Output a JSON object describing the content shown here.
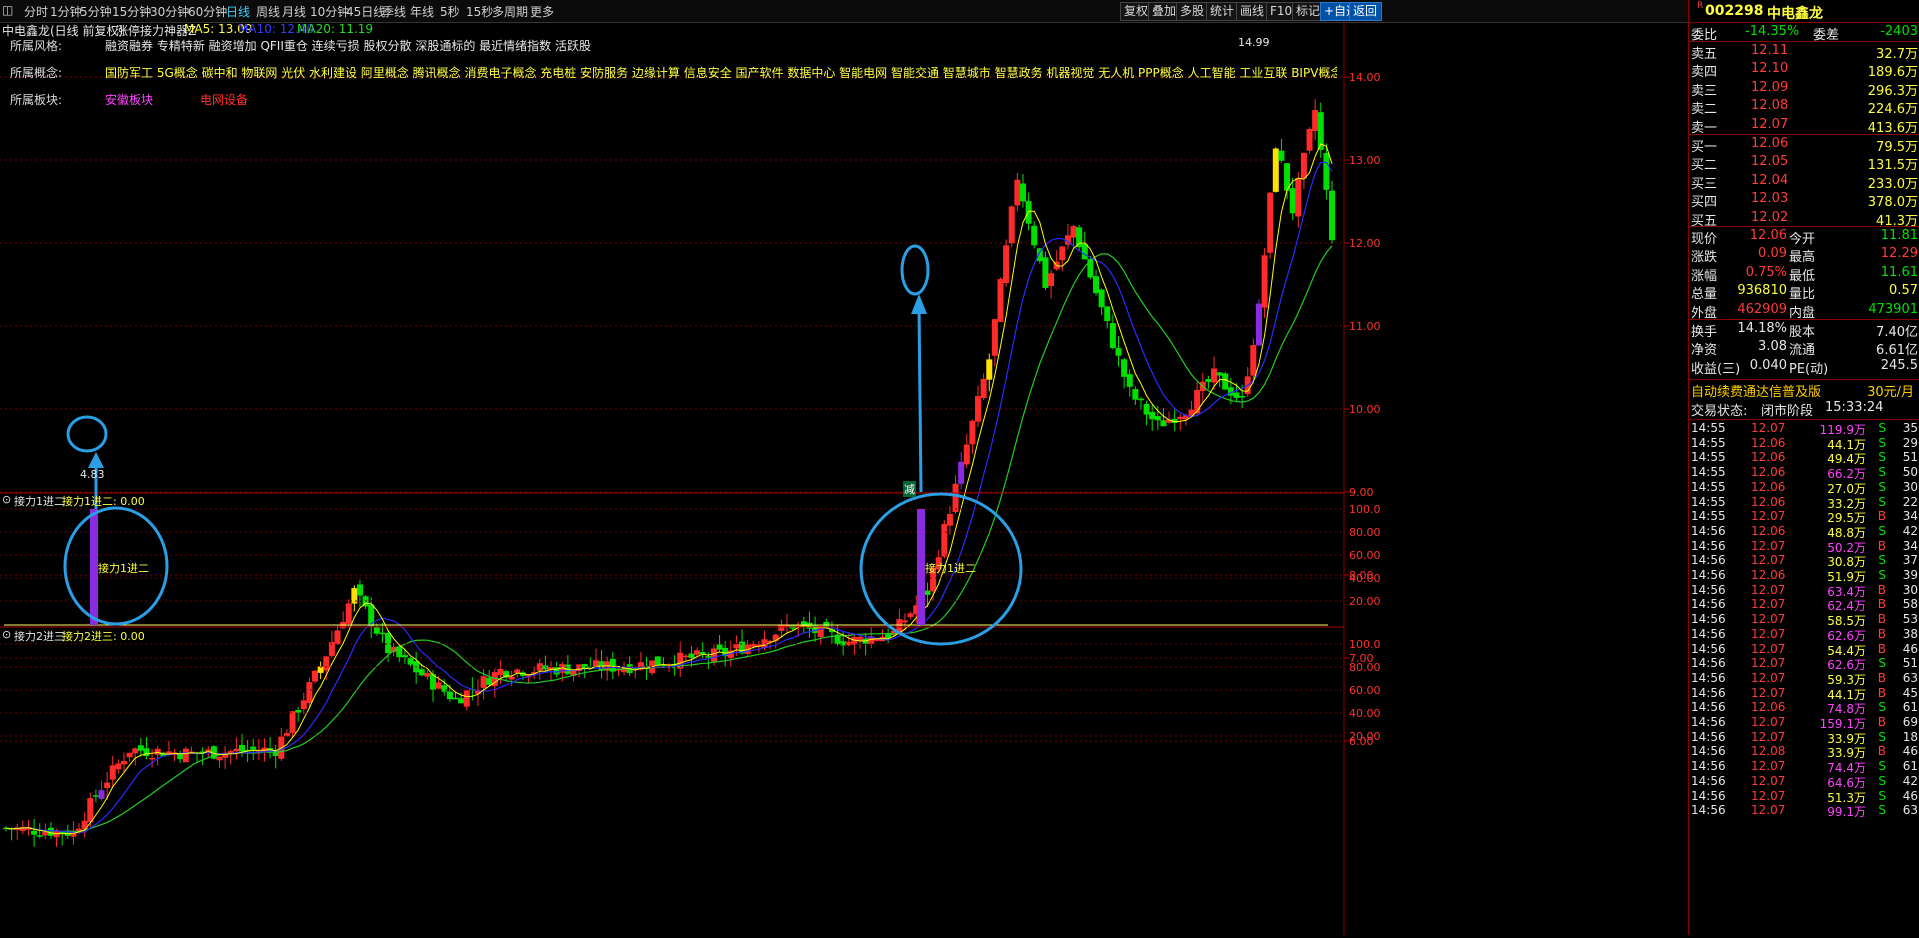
{
  "toolbar": {
    "left_items": [
      "分时",
      "1分钟",
      "5分钟",
      "15分钟",
      "30分钟",
      "60分钟",
      "日线",
      "周线",
      "月线",
      "10分钟",
      "45日线",
      "季线",
      "年线",
      "5秒",
      "15秒",
      "多周期",
      "更多"
    ],
    "active": "日线",
    "right_buttons": [
      "复权",
      "叠加",
      "多股",
      "统计",
      "画线",
      "F10",
      "标记",
      "+自选",
      "返回"
    ]
  },
  "chart": {
    "title": "中电鑫龙(日线 前复权)",
    "indicator_name": "涨停接力神器Z",
    "ma5_label": "MA5: 13.09",
    "ma10_label": "MA10: 12.40",
    "ma20_label": "MA20: 11.19",
    "style_label": "所属风格:",
    "style_value": "融资融券 专精特新 融资增加 QFII重仓 连续亏损 股权分散 深股通标的 最近情绪指数 活跃股",
    "concept_label": "所属概念:",
    "concept_value": "国防军工 5G概念 碳中和 物联网 光伏 水利建设 阿里概念 腾讯概念 消费电子概念 充电桩 安防服务 边缘计算 信息安全 国产软件 数据中心 智能电网 智能交通 智慧城市 智慧政务 机器视觉 无人机 PPP概念 人工智能 工业互联 BIPV概念 储能 绿色电力 信创 东数西算 虚拟电厂 AIGC概念 数据",
    "sector_label": "所属板块:",
    "sector_1": "安徽板块",
    "sector_2": "电网设备",
    "price_ticks": [
      "14.00",
      "13.00",
      "12.00",
      "11.00",
      "10.00",
      "9.00",
      "8.00",
      "7.00",
      "6.00"
    ],
    "high_label": "14.99",
    "low_label": "4.83",
    "jian_marker": "减",
    "sub1_title": "接力1进二",
    "sub1_value": "接力1进二: 0.00",
    "sub1_annotation": "接力1进二",
    "sub2_title": "接力2进三",
    "sub2_value": "接力2进三: 0.00",
    "sub_ticks": [
      "100.0",
      "80.00",
      "60.00",
      "40.00",
      "20.00"
    ]
  },
  "quote": {
    "code": "002298",
    "name": "中电鑫龙",
    "wb_label": "委比",
    "wb_value": "-14.35%",
    "wc_label": "委差",
    "wc_value": "-2403",
    "asks": [
      {
        "label": "卖五",
        "price": "12.11",
        "vol": "32.7万"
      },
      {
        "label": "卖四",
        "price": "12.10",
        "vol": "189.6万"
      },
      {
        "label": "卖三",
        "price": "12.09",
        "vol": "296.3万"
      },
      {
        "label": "卖二",
        "price": "12.08",
        "vol": "224.6万"
      },
      {
        "label": "卖一",
        "price": "12.07",
        "vol": "413.6万"
      }
    ],
    "bids": [
      {
        "label": "买一",
        "price": "12.06",
        "vol": "79.5万"
      },
      {
        "label": "买二",
        "price": "12.05",
        "vol": "131.5万"
      },
      {
        "label": "买三",
        "price": "12.04",
        "vol": "233.0万"
      },
      {
        "label": "买四",
        "price": "12.03",
        "vol": "378.0万"
      },
      {
        "label": "买五",
        "price": "12.02",
        "vol": "41.3万"
      }
    ],
    "stats1": [
      {
        "l1": "现价",
        "v1": "12.06",
        "c1": "red",
        "l2": "今开",
        "v2": "11.81",
        "c2": "green"
      },
      {
        "l1": "涨跌",
        "v1": "0.09",
        "c1": "red",
        "l2": "最高",
        "v2": "12.29",
        "c2": "red"
      },
      {
        "l1": "涨幅",
        "v1": "0.75%",
        "c1": "red",
        "l2": "最低",
        "v2": "11.61",
        "c2": "green"
      },
      {
        "l1": "总量",
        "v1": "936810",
        "c1": "yellow",
        "l2": "量比",
        "v2": "0.57",
        "c2": "yellow"
      },
      {
        "l1": "外盘",
        "v1": "462909",
        "c1": "red",
        "l2": "内盘",
        "v2": "473901",
        "c2": "green"
      }
    ],
    "stats2": [
      {
        "l1": "换手",
        "v1": "14.18%",
        "l2": "股本",
        "v2": "7.40亿"
      },
      {
        "l1": "净资",
        "v1": "3.08",
        "l2": "流通",
        "v2": "6.61亿"
      },
      {
        "l1": "收益(三)",
        "v1": "0.040",
        "l2": "PE(动)",
        "v2": "245.5"
      }
    ],
    "promo": "自动续费通达信普及版",
    "promo_price": "30元/月",
    "status_label": "交易状态:",
    "status_value": "闭市阶段",
    "status_time": "15:33:24",
    "ticks": [
      {
        "t": "14:55",
        "p": "12.07",
        "v": "119.9万",
        "s": "S",
        "n": "35",
        "pc": "red",
        "vc": "magenta"
      },
      {
        "t": "14:55",
        "p": "12.06",
        "v": "44.1万",
        "s": "S",
        "n": "29",
        "pc": "red",
        "vc": "yellow"
      },
      {
        "t": "14:55",
        "p": "12.06",
        "v": "49.4万",
        "s": "S",
        "n": "51",
        "pc": "red",
        "vc": "yellow"
      },
      {
        "t": "14:55",
        "p": "12.06",
        "v": "66.2万",
        "s": "S",
        "n": "50",
        "pc": "red",
        "vc": "magenta"
      },
      {
        "t": "14:55",
        "p": "12.06",
        "v": "27.0万",
        "s": "S",
        "n": "30",
        "pc": "red",
        "vc": "yellow"
      },
      {
        "t": "14:55",
        "p": "12.06",
        "v": "33.2万",
        "s": "S",
        "n": "22",
        "pc": "red",
        "vc": "yellow"
      },
      {
        "t": "14:55",
        "p": "12.07",
        "v": "29.5万",
        "s": "B",
        "n": "34",
        "pc": "red",
        "vc": "yellow"
      },
      {
        "t": "14:56",
        "p": "12.06",
        "v": "48.8万",
        "s": "S",
        "n": "42",
        "pc": "red",
        "vc": "yellow"
      },
      {
        "t": "14:56",
        "p": "12.07",
        "v": "50.2万",
        "s": "B",
        "n": "34",
        "pc": "red",
        "vc": "magenta"
      },
      {
        "t": "14:56",
        "p": "12.07",
        "v": "30.8万",
        "s": "S",
        "n": "37",
        "pc": "red",
        "vc": "yellow"
      },
      {
        "t": "14:56",
        "p": "12.06",
        "v": "51.9万",
        "s": "S",
        "n": "39",
        "pc": "red",
        "vc": "yellow"
      },
      {
        "t": "14:56",
        "p": "12.07",
        "v": "63.4万",
        "s": "B",
        "n": "30",
        "pc": "red",
        "vc": "magenta"
      },
      {
        "t": "14:56",
        "p": "12.07",
        "v": "62.4万",
        "s": "B",
        "n": "58",
        "pc": "red",
        "vc": "magenta"
      },
      {
        "t": "14:56",
        "p": "12.07",
        "v": "58.5万",
        "s": "B",
        "n": "53",
        "pc": "red",
        "vc": "yellow"
      },
      {
        "t": "14:56",
        "p": "12.07",
        "v": "62.6万",
        "s": "B",
        "n": "38",
        "pc": "red",
        "vc": "magenta"
      },
      {
        "t": "14:56",
        "p": "12.07",
        "v": "54.4万",
        "s": "B",
        "n": "46",
        "pc": "red",
        "vc": "yellow"
      },
      {
        "t": "14:56",
        "p": "12.07",
        "v": "62.6万",
        "s": "S",
        "n": "51",
        "pc": "red",
        "vc": "magenta"
      },
      {
        "t": "14:56",
        "p": "12.07",
        "v": "59.3万",
        "s": "B",
        "n": "63",
        "pc": "red",
        "vc": "yellow"
      },
      {
        "t": "14:56",
        "p": "12.07",
        "v": "44.1万",
        "s": "B",
        "n": "45",
        "pc": "red",
        "vc": "yellow"
      },
      {
        "t": "14:56",
        "p": "12.06",
        "v": "74.8万",
        "s": "S",
        "n": "61",
        "pc": "red",
        "vc": "magenta"
      },
      {
        "t": "14:56",
        "p": "12.07",
        "v": "159.1万",
        "s": "B",
        "n": "69",
        "pc": "red",
        "vc": "magenta"
      },
      {
        "t": "14:56",
        "p": "12.07",
        "v": "33.9万",
        "s": "S",
        "n": "18",
        "pc": "red",
        "vc": "yellow"
      },
      {
        "t": "14:56",
        "p": "12.08",
        "v": "33.9万",
        "s": "B",
        "n": "46",
        "pc": "red",
        "vc": "yellow"
      },
      {
        "t": "14:56",
        "p": "12.07",
        "v": "74.4万",
        "s": "S",
        "n": "61",
        "pc": "red",
        "vc": "magenta"
      },
      {
        "t": "14:56",
        "p": "12.07",
        "v": "64.6万",
        "s": "S",
        "n": "42",
        "pc": "red",
        "vc": "magenta"
      },
      {
        "t": "14:56",
        "p": "12.07",
        "v": "51.3万",
        "s": "S",
        "n": "46",
        "pc": "red",
        "vc": "yellow"
      },
      {
        "t": "14:56",
        "p": "12.07",
        "v": "99.1万",
        "s": "S",
        "n": "63",
        "pc": "red",
        "vc": "magenta"
      }
    ]
  },
  "colors": {
    "up": "#ff2a2a",
    "down": "#00e000",
    "limit_up": "#ffe000",
    "signal": "#8a2be2",
    "ma5": "#ffff00",
    "ma10": "#2a2aff",
    "ma20": "#22cc22",
    "annotation": "#2a9fe6"
  },
  "chart_data": {
    "type": "candlestick",
    "price_range": [
      4.83,
      14.99
    ],
    "signals": [
      "接力1进二",
      "接力1进二"
    ]
  }
}
